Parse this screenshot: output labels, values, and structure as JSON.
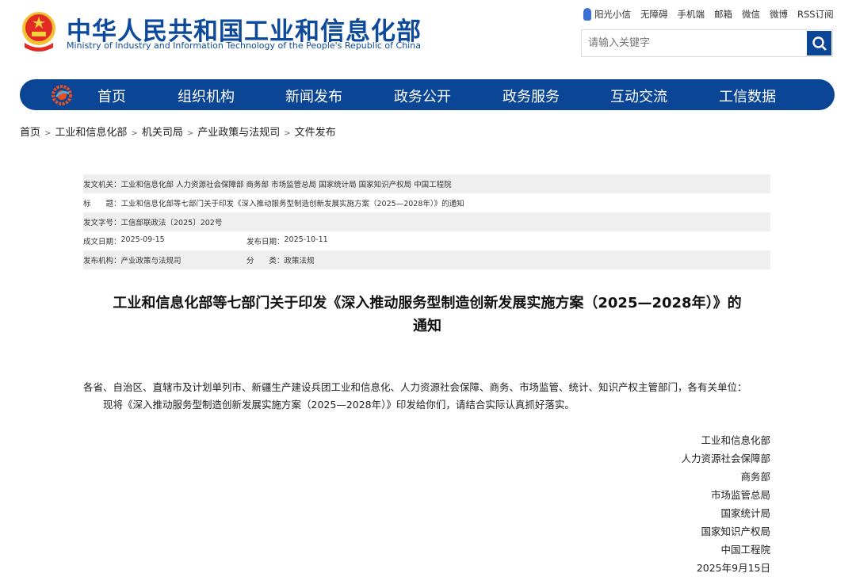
{
  "header": {
    "title_cn": "中华人民共和国工业和信息化部",
    "title_en": "Ministry of Industry and Information Technology of the People's Republic of China",
    "top_links": [
      "阳光小信",
      "无障碍",
      "手机端",
      "邮箱",
      "微信",
      "微博",
      "RSS订阅"
    ],
    "search_placeholder": "请输入关键字"
  },
  "nav": [
    "首页",
    "组织机构",
    "新闻发布",
    "政务公开",
    "政务服务",
    "互动交流",
    "工信数据"
  ],
  "breadcrumb": [
    "首页",
    "工业和信息化部",
    "机关司局",
    "产业政策与法规司",
    "文件发布"
  ],
  "info": {
    "issuer_label": "发文机关：",
    "issuer": "工业和信息化部 人力资源社会保障部 商务部 市场监管总局 国家统计局 国家知识产权局 中国工程院",
    "title_label": "标　　题：",
    "title": "工业和信息化部等七部门关于印发《深入推动服务型制造创新发展实施方案（2025—2028年）》的通知",
    "docno_label": "发文字号：",
    "docno": "工信部联政法〔2025〕202号",
    "written_label": "成文日期：",
    "written": "2025-09-15",
    "published_label": "发布日期：",
    "published": "2025-10-11",
    "org_label": "发布机构：",
    "org": "产业政策与法规司",
    "category_label": "分　　类：",
    "category": "政策法规"
  },
  "article": {
    "title_line1": "工业和信息化部等七部门关于印发《深入推动服务型制造创新发展实施方案（2025—2028年）》的",
    "title_line2": "通知",
    "salutation": "各省、自治区、直辖市及计划单列市、新疆生产建设兵团工业和信息化、人力资源社会保障、商务、市场监管、统计、知识产权主管部门，各有关单位：",
    "para1": "　　现将《深入推动服务型制造创新发展实施方案（2025—2028年）》印发给你们，请结合实际认真抓好落实。",
    "signatures": [
      "工业和信息化部",
      "人力资源社会保障部",
      "商务部",
      "市场监管总局",
      "国家统计局",
      "国家知识产权局",
      "中国工程院",
      "2025年9月15日"
    ]
  }
}
